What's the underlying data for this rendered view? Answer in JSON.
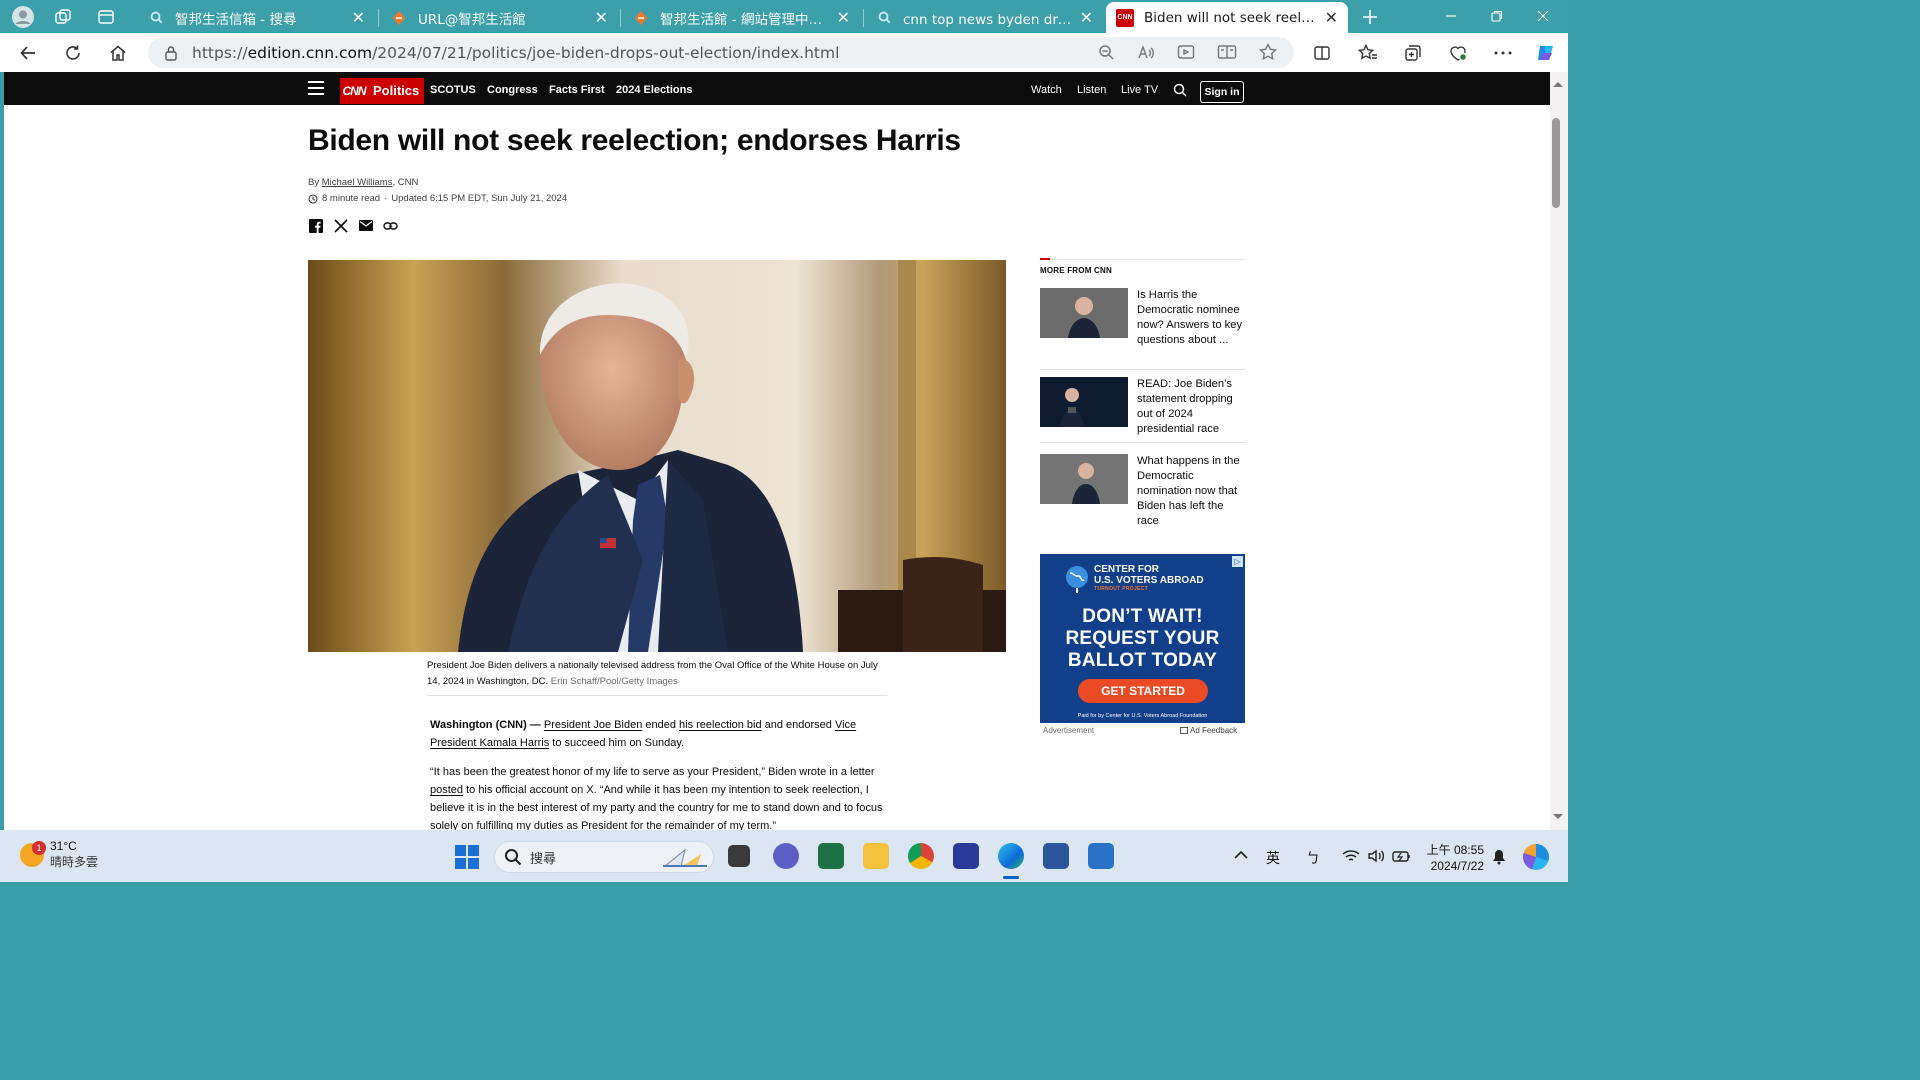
{
  "browser": {
    "tabs": [
      {
        "title": "智邦生活信箱 - 搜尋",
        "favicon": "search-icon"
      },
      {
        "title": "URL@智邦生活館",
        "favicon": "zhibang-icon"
      },
      {
        "title": "智邦生活館 - 網站管理中心 - 最新",
        "favicon": "zhibang-icon"
      },
      {
        "title": "cnn top news byden drop out - 搜尋",
        "favicon": "search-icon"
      },
      {
        "title": "Biden will not seek reelection; endorses Harris",
        "favicon": "cnn-icon",
        "active": true
      }
    ],
    "url_prefix": "https://",
    "url_host": "edition.cnn.com",
    "url_path": "/2024/07/21/politics/joe-biden-drops-out-election/index.html"
  },
  "cnn": {
    "logo": "CNN",
    "section": "Politics",
    "nav_left": [
      "SCOTUS",
      "Congress",
      "Facts First",
      "2024 Elections"
    ],
    "nav_right": [
      "Watch",
      "Listen",
      "Live TV"
    ],
    "sign_in": "Sign in"
  },
  "article": {
    "headline": "Biden will not seek reelection; endorses Harris",
    "byline_prefix": "By ",
    "author": "Michael Williams",
    "byline_suffix": ", CNN",
    "read_time": "8 minute read",
    "separator": "·",
    "updated": "Updated 6:15 PM EDT, Sun July 21, 2024",
    "caption": "President Joe Biden delivers a nationally televised address from the Oval Office of the White House on July 14, 2024 in Washington, DC.",
    "credit": "Erin Schaff/Pool/Getty Images",
    "p1": {
      "dateline": "Washington (CNN) —",
      "link1": "President Joe Biden",
      "t1": " ended ",
      "link2": "his reelection bid",
      "t2": " and endorsed ",
      "link3": "Vice President Kamala Harris",
      "t3": " to succeed him on Sunday."
    },
    "p2": {
      "t1": "“It has been the greatest honor of my life to serve as your President,” Biden wrote in a letter ",
      "link": "posted",
      "t2": " to his official account on X. “And while it has been my intention to seek reelection, I believe it is in the best interest of my party and the country for me to stand down and to focus solely on fulfilling my duties as President for the remainder of my term.”"
    }
  },
  "rail": {
    "title": "MORE FROM CNN",
    "items": [
      {
        "text": "Is Harris the Democratic nominee now? Answers to key questions about ..."
      },
      {
        "text": "READ: Joe Biden’s statement dropping out of 2024 presidential race"
      },
      {
        "text": "What happens in the Democratic nomination now that Biden has left the race"
      }
    ]
  },
  "ad": {
    "org_line1": "CENTER FOR",
    "org_line2": "U.S. VOTERS ABROAD",
    "org_sub": "TURNOUT PROJECT",
    "line1": "DON’T WAIT!",
    "line2": "REQUEST YOUR",
    "line3": "BALLOT TODAY",
    "cta": "GET STARTED",
    "paid_by": "Paid for by Center for U.S. Voters Abroad Foundation",
    "label": "Advertisement",
    "feedback": "Ad Feedback"
  },
  "taskbar": {
    "weather_badge": "1",
    "temp": "31°C",
    "condition": "晴時多雲",
    "search_label": "搜尋",
    "ime1": "英",
    "ime2": "ㄅ",
    "time": "上午 08:55",
    "date": "2024/7/22"
  },
  "colors": {
    "brand_red": "#cc0000",
    "tab_bar": "#3ba0aa",
    "ad_blue": "#123f8a",
    "ad_orange": "#ea4b24"
  }
}
